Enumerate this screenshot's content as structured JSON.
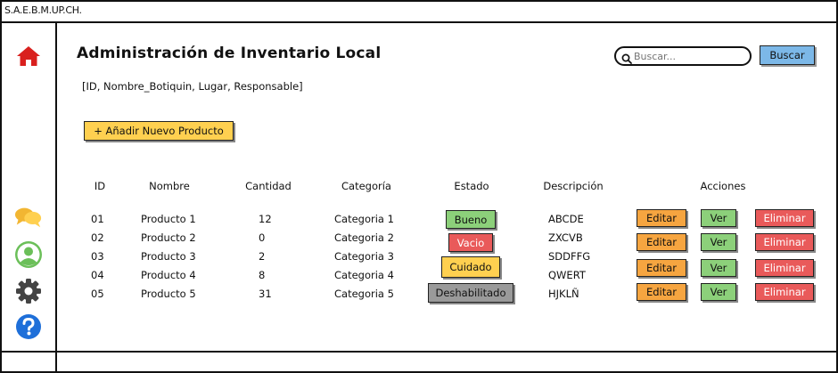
{
  "app": {
    "title": "S.A.E.B.M.UP.CH."
  },
  "header": {
    "title": "Administración de Inventario Local",
    "fields_note": "[ID, Nombre_Botiquin, Lugar, Responsable]"
  },
  "search": {
    "placeholder": "Buscar...",
    "button_label": "Buscar"
  },
  "toolbar": {
    "add_label": "+ Añadir Nuevo Producto"
  },
  "table": {
    "headers": [
      "ID",
      "Nombre",
      "Cantidad",
      "Categoría",
      "Estado",
      "Descripción",
      "Acciones"
    ],
    "rows": [
      {
        "id": "01",
        "nombre": "Producto 1",
        "cantidad": "12",
        "categoria": "Categoria 1",
        "estado": "Bueno",
        "descripcion": "ABCDE"
      },
      {
        "id": "02",
        "nombre": "Producto 2",
        "cantidad": "0",
        "categoria": "Categoria 2",
        "estado": "Vacio",
        "descripcion": "ZXCVB"
      },
      {
        "id": "03",
        "nombre": "Producto 3",
        "cantidad": "2",
        "categoria": "Categoria 3",
        "estado": "Cuidado",
        "descripcion": "SDDFFG"
      },
      {
        "id": "04",
        "nombre": "Producto 4",
        "cantidad": "8",
        "categoria": "Categoria 4",
        "estado": "",
        "descripcion": "QWERT"
      },
      {
        "id": "05",
        "nombre": "Producto 5",
        "cantidad": "31",
        "categoria": "Categoria 5",
        "estado": "Deshabilitado",
        "descripcion": "HJKLÑ"
      }
    ],
    "actions": {
      "edit": "Editar",
      "view": "Ver",
      "delete": "Eliminar"
    }
  },
  "colors": {
    "bueno": "#8cd07a",
    "vacio": "#e95a5a",
    "cuidado": "#ffd050",
    "deshabilitado": "#9a9a9a",
    "accent": "#7cb8e8",
    "home_icon": "#d9201e",
    "chat_icon": "#ffd050",
    "user_icon": "#6bbf59",
    "help_icon": "#1e6fd9"
  },
  "icons": {
    "sidebar": [
      "home-icon",
      "chat-icon",
      "user-circle-icon",
      "gear-icon",
      "help-icon"
    ],
    "search": "search-icon"
  }
}
